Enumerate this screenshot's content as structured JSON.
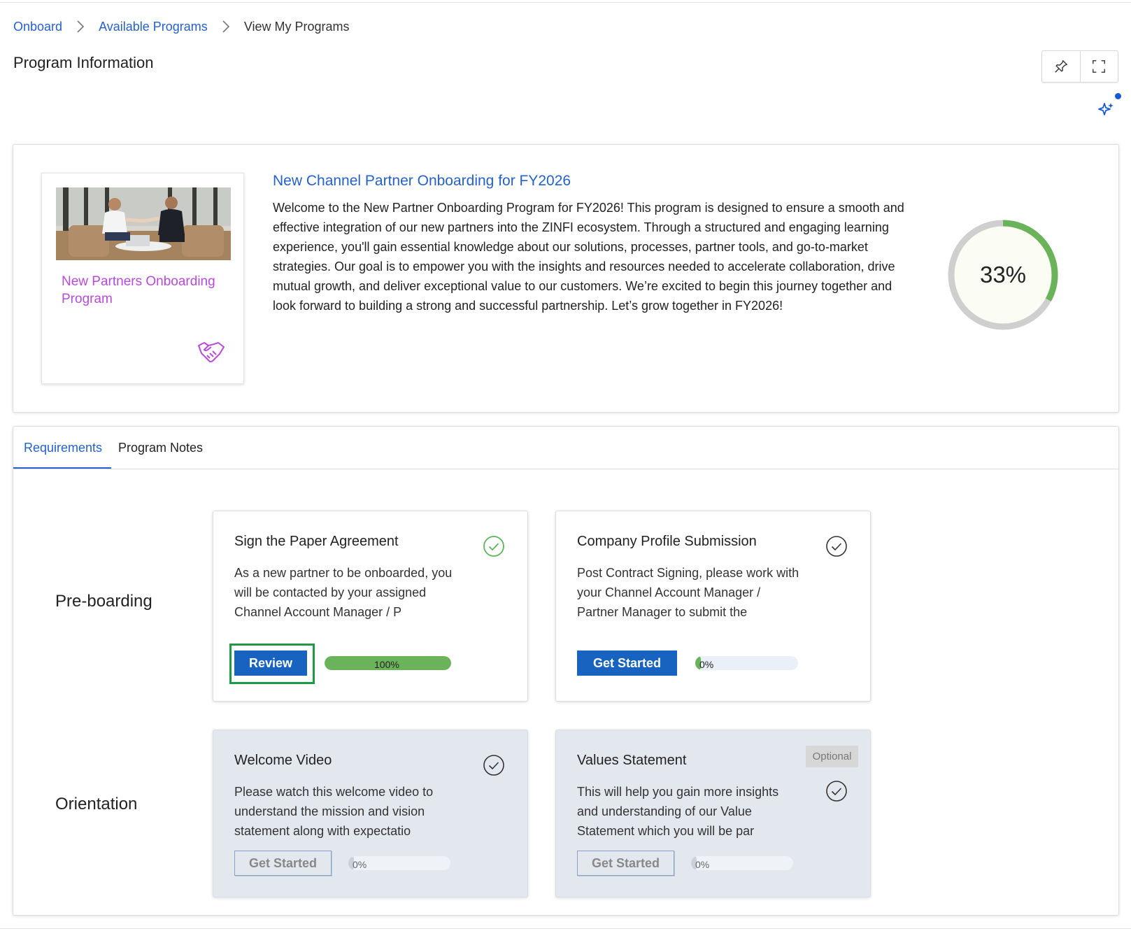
{
  "breadcrumb": {
    "items": [
      "Onboard",
      "Available Programs"
    ],
    "current": "View My Programs"
  },
  "page": {
    "title": "Program Information"
  },
  "toolbar": {
    "pin_icon": "pin-icon",
    "fullscreen_icon": "fullscreen-icon",
    "ai_icon": "sparkle-icon"
  },
  "program": {
    "thumbnail_label": "New Partners Onboarding Program",
    "title": "New Channel Partner Onboarding for FY2026",
    "description": "Welcome to the New Partner Onboarding Program for FY2026! This program is designed to ensure a smooth and effective integration of our new partners into the ZINFI ecosystem. Through a structured and engaging learning experience, you'll gain essential knowledge about our solutions, processes, partner tools, and go-to-market strategies. Our goal is to empower you with the insights and resources needed to accelerate collaboration, drive mutual growth, and deliver exceptional value to our customers. We’re excited to begin this journey together and look forward to building a strong and successful partnership. Let’s grow together in FY2026!",
    "progress": 33,
    "progress_label": "33%"
  },
  "tabs": [
    {
      "label": "Requirements",
      "active": true
    },
    {
      "label": "Program Notes",
      "active": false
    }
  ],
  "sections": [
    {
      "label": "Pre-boarding",
      "tasks": [
        {
          "title": "Sign the Paper Agreement",
          "description": "As a new partner to be onboarded, you will be contacted by your assigned Channel Account Manager / P",
          "button": "Review",
          "progress": 100,
          "progress_label": "100%",
          "completed": true
        },
        {
          "title": "Company Profile Submission",
          "description": "Post Contract Signing, please work with your Channel Account Manager / Partner Manager to submit the",
          "button": "Get Started",
          "progress": 0,
          "progress_label": "0%",
          "completed": false
        }
      ]
    },
    {
      "label": "Orientation",
      "tasks": [
        {
          "title": "Welcome Video",
          "description": "Please watch this welcome video to understand the mission and vision statement along with expectatio",
          "button": "Get Started",
          "progress": 0,
          "progress_label": "0%",
          "completed": false
        },
        {
          "title": "Values Statement",
          "badge": "Optional",
          "description": "This will help you gain more insights and understanding of our Value Statement which you will be par",
          "button": "Get Started",
          "progress": 0,
          "progress_label": "0%",
          "completed": false
        }
      ]
    }
  ],
  "colors": {
    "link": "#2461c9",
    "accent_green": "#6ab35a",
    "primary_button": "#1763bf",
    "thumb_label": "#b74ad9",
    "locked_card_bg": "#e3e7ee"
  }
}
